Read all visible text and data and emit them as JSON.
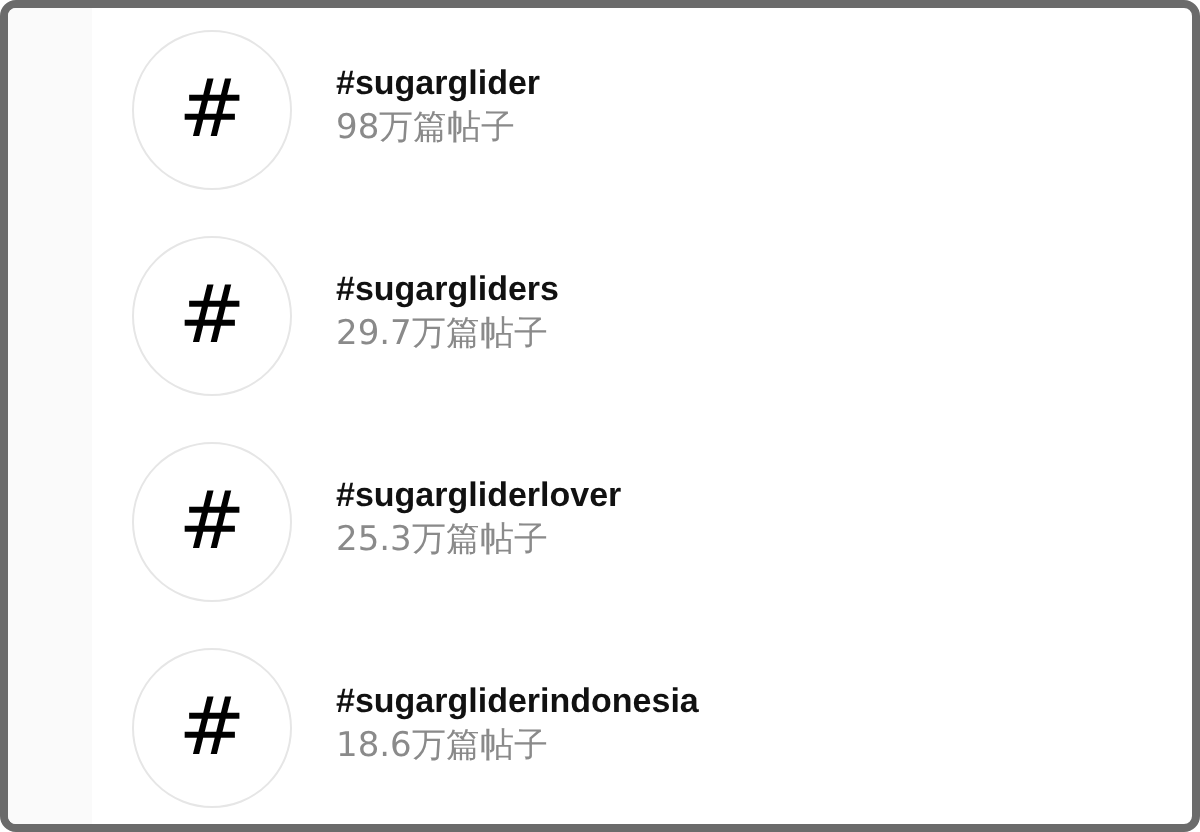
{
  "hashtags": [
    {
      "symbol": "#",
      "tag": "#sugarglider",
      "posts": "98万篇帖子"
    },
    {
      "symbol": "#",
      "tag": "#sugargliders",
      "posts": "29.7万篇帖子"
    },
    {
      "symbol": "#",
      "tag": "#sugargliderlover",
      "posts": "25.3万篇帖子"
    },
    {
      "symbol": "#",
      "tag": "#sugargliderindonesia",
      "posts": "18.6万篇帖子"
    }
  ]
}
